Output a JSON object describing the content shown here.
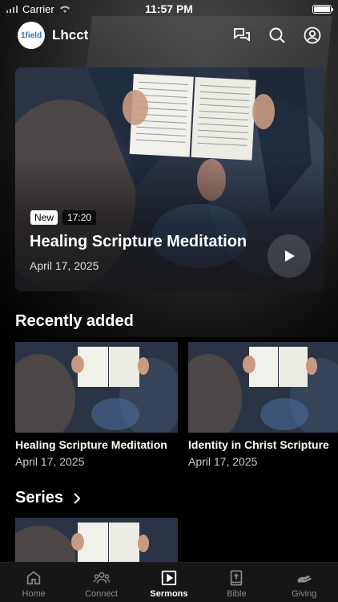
{
  "status_bar": {
    "carrier": "Carrier",
    "time": "11:57 PM",
    "battery_level": 1.0
  },
  "header": {
    "logo_text": "1field",
    "app_title": "Lhcct",
    "actions": [
      "chat-icon",
      "search-icon",
      "account-icon"
    ]
  },
  "hero": {
    "badge_new": "New",
    "duration": "17:20",
    "title": "Healing Scripture Meditation",
    "date": "April 17, 2025"
  },
  "recently_added": {
    "title": "Recently added",
    "items": [
      {
        "title": "Healing Scripture Meditation",
        "date": "April 17, 2025"
      },
      {
        "title": "Identity in Christ Scripture",
        "date": "April 17, 2025"
      }
    ]
  },
  "series": {
    "title": "Series"
  },
  "tabs": [
    {
      "label": "Home",
      "icon": "home-icon",
      "active": false
    },
    {
      "label": "Connect",
      "icon": "people-icon",
      "active": false
    },
    {
      "label": "Sermons",
      "icon": "play-square-icon",
      "active": true
    },
    {
      "label": "Bible",
      "icon": "bible-icon",
      "active": false
    },
    {
      "label": "Giving",
      "icon": "giving-icon",
      "active": false
    }
  ],
  "colors": {
    "background": "#000000",
    "tab_bar": "#161616",
    "logo_accent": "#2b78c2"
  }
}
